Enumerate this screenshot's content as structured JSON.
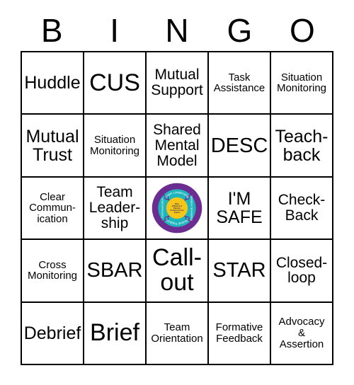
{
  "card": {
    "header_letters": [
      "B",
      "I",
      "N",
      "G",
      "O"
    ],
    "rows": [
      [
        {
          "text": "Huddle",
          "size": "lg"
        },
        {
          "text": "CUS",
          "size": "xxl"
        },
        {
          "text": "Mutual\nSupport",
          "size": "md"
        },
        {
          "text": "Task\nAssistance",
          "size": "sm"
        },
        {
          "text": "Situation\nMonitoring",
          "size": "sm"
        }
      ],
      [
        {
          "text": "Mutual\nTrust",
          "size": "lg"
        },
        {
          "text": "Situation\nMonitoring",
          "size": "sm"
        },
        {
          "text": "Shared\nMental\nModel",
          "size": "md"
        },
        {
          "text": "DESC",
          "size": "xl"
        },
        {
          "text": "Teach-\nback",
          "size": "lg"
        }
      ],
      [
        {
          "text": "Clear\nCommun-\nication",
          "size": "sm"
        },
        {
          "text": "Team\nLeader-\nship",
          "size": "md"
        },
        {
          "type": "logo",
          "text": "",
          "size": "sm"
        },
        {
          "text": "I'M\nSAFE",
          "size": "lg"
        },
        {
          "text": "Check-\nBack",
          "size": "md"
        }
      ],
      [
        {
          "text": "Cross\nMonitoring",
          "size": "sm"
        },
        {
          "text": "SBAR",
          "size": "xl"
        },
        {
          "text": "Call-\nout",
          "size": "xxl"
        },
        {
          "text": "STAR",
          "size": "xl"
        },
        {
          "text": "Closed-\nloop",
          "size": "md"
        }
      ],
      [
        {
          "text": "Debrief",
          "size": "lg"
        },
        {
          "text": "Brief",
          "size": "xxl"
        },
        {
          "text": "Team\nOrientation",
          "size": "sm"
        },
        {
          "text": "Formative\nFeedback",
          "size": "sm"
        },
        {
          "text": "Advocacy\n&\nAssertion",
          "size": "sm"
        }
      ]
    ]
  },
  "logo": {
    "name": "teamstepps-logo",
    "center_text": "Safe,\nEfficient &\nPatient-\nCentered Care\nTeams",
    "ring_labels": {
      "top": "Team Leadership",
      "right": "Situation Monitoring",
      "bottom": "Mutual Support",
      "left": "Communication"
    },
    "colors": {
      "outer_ring": "#6b2d8f",
      "inner_ring": "#1fb5bc",
      "center": "#f5c518",
      "ring_text": "#ffffff",
      "center_text": "#3a2a6b"
    }
  },
  "style": {
    "border_color": "#000000",
    "cell_background": "#ffffff",
    "page_background": "#ffffff",
    "text_color": "#000000"
  }
}
